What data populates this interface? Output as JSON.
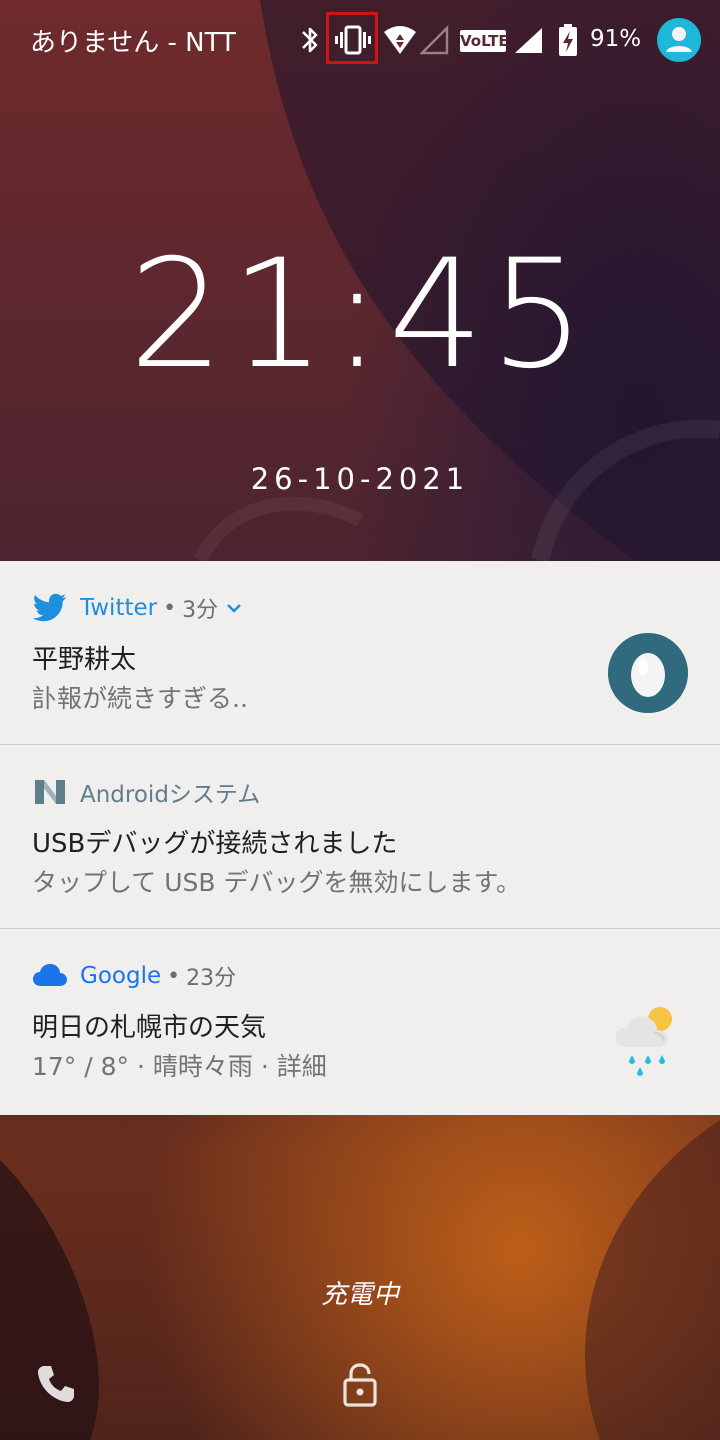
{
  "status_bar": {
    "carrier": "ありません - NTT",
    "icons": [
      "bluetooth-icon",
      "vibrate-icon",
      "wifi-icon",
      "signal-empty-icon",
      "volte-icon",
      "signal-full-icon",
      "battery-charging-icon"
    ],
    "volte_label": "VoLTE",
    "battery_percent": "91%",
    "highlight_color": "#d0141a"
  },
  "lockscreen": {
    "time_hours": "21",
    "time_colon": ":",
    "time_minutes": "45",
    "date": "26-10-2021",
    "charging_label": "充電中"
  },
  "notifications": [
    {
      "app": "Twitter",
      "app_color": "#1d8fdc",
      "time": "3分",
      "title": "平野耕太",
      "text": "訃報が続きすぎる..",
      "icon": "twitter-bird-icon",
      "thumbnail": "egg-avatar"
    },
    {
      "app": "Androidシステム",
      "app_color": "#607d8b",
      "title": "USBデバッグが接続されました",
      "text": "タップして USB デバッグを無効にします。",
      "icon": "android-n-icon"
    },
    {
      "app": "Google",
      "app_color": "#1a73e8",
      "time": "23分",
      "title": "明日の札幌市の天気",
      "text": "17° / 8° · 晴時々雨 · 詳細",
      "icon": "cloud-icon",
      "thumbnail": "weather-sun-rain-icon"
    }
  ],
  "bottom": {
    "left_shortcut": "phone-icon",
    "center": "lock-icon"
  },
  "separator": "•"
}
